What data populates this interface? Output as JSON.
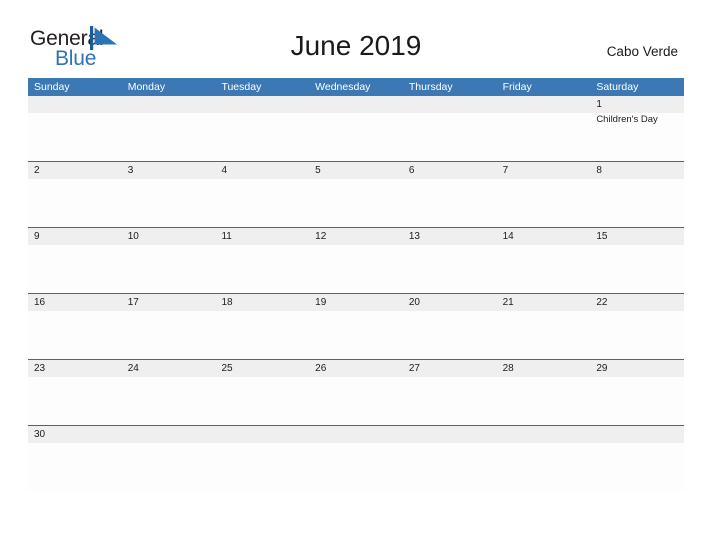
{
  "brand": {
    "word_one": "General",
    "word_two": "Blue",
    "mark": "triangle-flag-icon",
    "colors": {
      "dark": "#231f20",
      "blue": "#2b74b8"
    }
  },
  "header": {
    "title": "June 2019",
    "country": "Cabo Verde"
  },
  "theme": {
    "header_blue": "#3b78b4",
    "row_divider_blue": "#2e6da4",
    "daynum_band": "#efefef",
    "cell_background": "#fdfdfd",
    "page_background": "#ffffff"
  },
  "calendar": {
    "weekdays": [
      "Sunday",
      "Monday",
      "Tuesday",
      "Wednesday",
      "Thursday",
      "Friday",
      "Saturday"
    ],
    "weeks": [
      {
        "days": [
          {
            "number": "",
            "events": []
          },
          {
            "number": "",
            "events": []
          },
          {
            "number": "",
            "events": []
          },
          {
            "number": "",
            "events": []
          },
          {
            "number": "",
            "events": []
          },
          {
            "number": "",
            "events": []
          },
          {
            "number": "1",
            "events": [
              "Children's Day"
            ]
          }
        ]
      },
      {
        "days": [
          {
            "number": "2",
            "events": []
          },
          {
            "number": "3",
            "events": []
          },
          {
            "number": "4",
            "events": []
          },
          {
            "number": "5",
            "events": []
          },
          {
            "number": "6",
            "events": []
          },
          {
            "number": "7",
            "events": []
          },
          {
            "number": "8",
            "events": []
          }
        ]
      },
      {
        "days": [
          {
            "number": "9",
            "events": []
          },
          {
            "number": "10",
            "events": []
          },
          {
            "number": "11",
            "events": []
          },
          {
            "number": "12",
            "events": []
          },
          {
            "number": "13",
            "events": []
          },
          {
            "number": "14",
            "events": []
          },
          {
            "number": "15",
            "events": []
          }
        ]
      },
      {
        "days": [
          {
            "number": "16",
            "events": []
          },
          {
            "number": "17",
            "events": []
          },
          {
            "number": "18",
            "events": []
          },
          {
            "number": "19",
            "events": []
          },
          {
            "number": "20",
            "events": []
          },
          {
            "number": "21",
            "events": []
          },
          {
            "number": "22",
            "events": []
          }
        ]
      },
      {
        "days": [
          {
            "number": "23",
            "events": []
          },
          {
            "number": "24",
            "events": []
          },
          {
            "number": "25",
            "events": []
          },
          {
            "number": "26",
            "events": []
          },
          {
            "number": "27",
            "events": []
          },
          {
            "number": "28",
            "events": []
          },
          {
            "number": "29",
            "events": []
          }
        ]
      },
      {
        "days": [
          {
            "number": "30",
            "events": []
          },
          {
            "number": "",
            "events": []
          },
          {
            "number": "",
            "events": []
          },
          {
            "number": "",
            "events": []
          },
          {
            "number": "",
            "events": []
          },
          {
            "number": "",
            "events": []
          },
          {
            "number": "",
            "events": []
          }
        ]
      }
    ]
  }
}
